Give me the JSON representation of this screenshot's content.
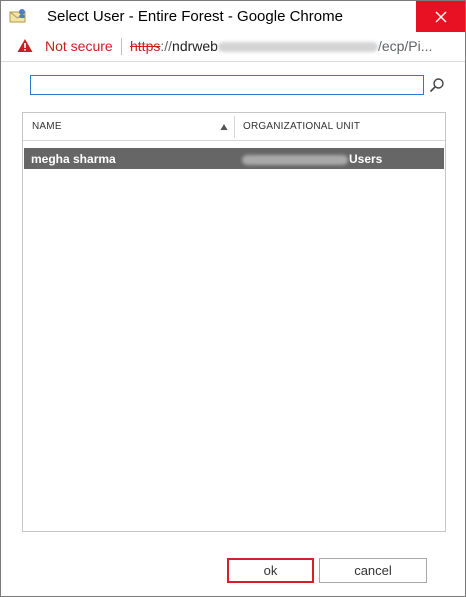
{
  "window": {
    "title": "Select User - Entire Forest - Google Chrome",
    "app_icon": "users-directory-icon",
    "close_icon": "close-icon"
  },
  "addressbar": {
    "security_icon": "warning-triangle-icon",
    "security_label": "Not secure",
    "url_scheme": "https",
    "url_scheme_sep": "://",
    "url_host_start": "ndrweb",
    "url_path_end": "/ecp/Pi..."
  },
  "search": {
    "value": "",
    "placeholder": "",
    "icon": "search-icon"
  },
  "list": {
    "columns": [
      {
        "label": "NAME",
        "sort": "ascending"
      },
      {
        "label": "ORGANIZATIONAL UNIT"
      }
    ],
    "rows": [
      {
        "name": "megha sharma",
        "ou_suffix": "Users",
        "selected": true
      }
    ]
  },
  "buttons": {
    "ok_label": "ok",
    "cancel_label": "cancel"
  },
  "colors": {
    "selection": "#666666",
    "focus_border": "#2b79d2",
    "close_button": "#e81123",
    "warning_red": "#c5221f",
    "ok_highlight": "#d81e2c"
  }
}
